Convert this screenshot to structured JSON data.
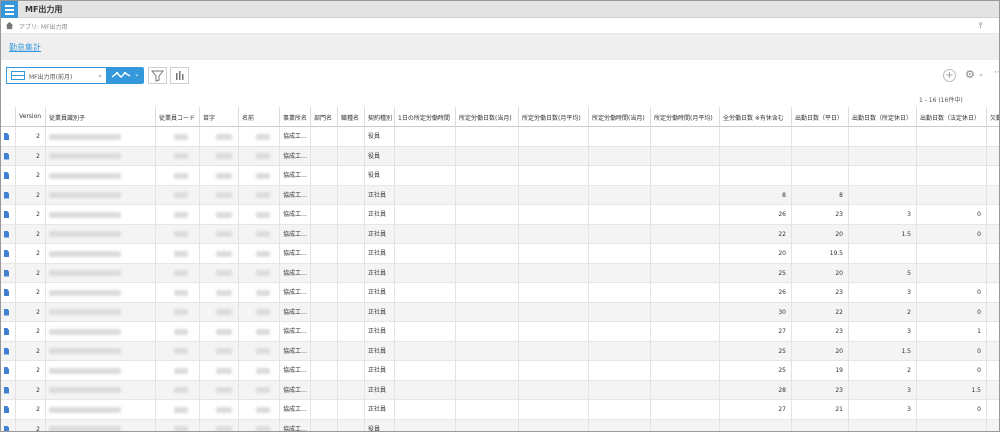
{
  "app": {
    "title": "MF出力用"
  },
  "nav": {
    "breadcrumb": "アプリ: MF出力用"
  },
  "tabs": {
    "link": "勤怠集計"
  },
  "toolbar": {
    "view_name": "MF出力用(前月)"
  },
  "pager": {
    "text": "1 - 16 (16件中)"
  },
  "columns": [
    {
      "key": "icon",
      "label": "",
      "w": 15
    },
    {
      "key": "version",
      "label": "Version",
      "w": 30,
      "num": true
    },
    {
      "key": "emp_id",
      "label": "従業員識別子",
      "w": 110,
      "blur": true
    },
    {
      "key": "emp_code",
      "label": "従業員コード",
      "w": 44,
      "blur": true
    },
    {
      "key": "sei",
      "label": "苗字",
      "w": 39,
      "blur": true
    },
    {
      "key": "mei",
      "label": "名前",
      "w": 41,
      "blur": true
    },
    {
      "key": "office",
      "label": "事業所名",
      "w": 31
    },
    {
      "key": "dept",
      "label": "部門名",
      "w": 27
    },
    {
      "key": "position",
      "label": "職種名",
      "w": 27
    },
    {
      "key": "contract",
      "label": "契約種別",
      "w": 30
    },
    {
      "key": "daily_hours",
      "label": "1日の所定労働時間",
      "w": 61
    },
    {
      "key": "days_month",
      "label": "所定労働日数(当月)",
      "w": 63
    },
    {
      "key": "days_avg",
      "label": "所定労働日数(月平均)",
      "w": 70
    },
    {
      "key": "hours_month",
      "label": "所定労働時間(当月)",
      "w": 62
    },
    {
      "key": "hours_avg",
      "label": "所定労働時間(月平均)",
      "w": 69,
      "num": true
    },
    {
      "key": "total_days",
      "label": "全労働日数 ※有休含む",
      "w": 72,
      "num": true
    },
    {
      "key": "work_weekday",
      "label": "出勤日数（平日）",
      "w": 57,
      "num": true
    },
    {
      "key": "work_holiday",
      "label": "出勤日数（所定休日）",
      "w": 68,
      "num": true
    },
    {
      "key": "work_legal",
      "label": "出勤日数（法定休日）",
      "w": 70,
      "num": true
    },
    {
      "key": "absent",
      "label": "欠勤",
      "w": 14
    }
  ],
  "rows": [
    {
      "version": "2",
      "office": "協成工…",
      "contract": "役員"
    },
    {
      "version": "2",
      "office": "協成工…",
      "contract": "役員"
    },
    {
      "version": "2",
      "office": "協成工…",
      "contract": "役員"
    },
    {
      "version": "2",
      "office": "協成工…",
      "contract": "正社員",
      "total_days": "8",
      "work_weekday": "8"
    },
    {
      "version": "2",
      "office": "協成工…",
      "contract": "正社員",
      "total_days": "26",
      "work_weekday": "23",
      "work_holiday": "3",
      "work_legal": "0"
    },
    {
      "version": "2",
      "office": "協成工…",
      "contract": "正社員",
      "total_days": "22",
      "work_weekday": "20",
      "work_holiday": "1.5",
      "work_legal": "0"
    },
    {
      "version": "2",
      "office": "協成工…",
      "contract": "正社員",
      "total_days": "20",
      "work_weekday": "19.5"
    },
    {
      "version": "2",
      "office": "協成工…",
      "contract": "正社員",
      "total_days": "25",
      "work_weekday": "20",
      "work_holiday": "5"
    },
    {
      "version": "2",
      "office": "協成工…",
      "contract": "正社員",
      "total_days": "26",
      "work_weekday": "23",
      "work_holiday": "3",
      "work_legal": "0"
    },
    {
      "version": "2",
      "office": "協成工…",
      "contract": "正社員",
      "total_days": "30",
      "work_weekday": "22",
      "work_holiday": "2",
      "work_legal": "0"
    },
    {
      "version": "2",
      "office": "協成工…",
      "contract": "正社員",
      "total_days": "27",
      "work_weekday": "23",
      "work_holiday": "3",
      "work_legal": "1"
    },
    {
      "version": "2",
      "office": "協成工…",
      "contract": "正社員",
      "total_days": "25",
      "work_weekday": "20",
      "work_holiday": "1.5",
      "work_legal": "0"
    },
    {
      "version": "2",
      "office": "協成工…",
      "contract": "正社員",
      "total_days": "25",
      "work_weekday": "19",
      "work_holiday": "2",
      "work_legal": "0"
    },
    {
      "version": "2",
      "office": "協成工…",
      "contract": "正社員",
      "total_days": "28",
      "work_weekday": "23",
      "work_holiday": "3",
      "work_legal": "1.5"
    },
    {
      "version": "2",
      "office": "協成工…",
      "contract": "正社員",
      "total_days": "27",
      "work_weekday": "21",
      "work_holiday": "3",
      "work_legal": "0"
    },
    {
      "version": "2",
      "office": "協成工…",
      "contract": "役員"
    }
  ],
  "colors": {
    "accent": "#3498db",
    "topbar": "#e4e4e4",
    "stripe": "#f4f4f4"
  }
}
